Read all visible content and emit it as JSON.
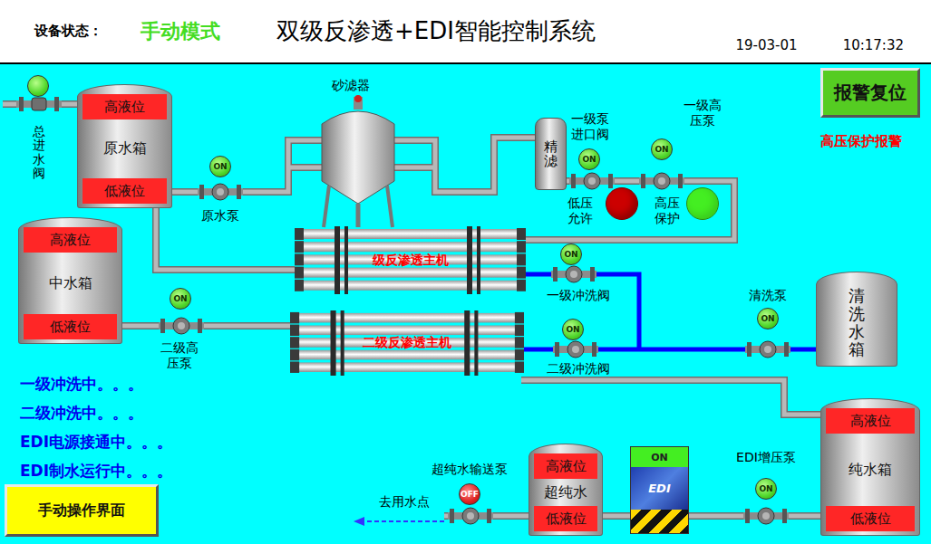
{
  "header": {
    "status_label": "设备状态：",
    "mode": "手动模式",
    "title": "双级反渗透+EDI智能控制系统",
    "date": "19-03-01",
    "time": "10:17:32"
  },
  "buttons": {
    "alarm_reset": "报警复位",
    "manual": "手动操作界面"
  },
  "alarm": "高压保护报警",
  "inlet_valve": {
    "label": "总进水阀",
    "on": true
  },
  "sand_filter": "砂滤器",
  "fine_filter": "精滤",
  "tanks": [
    {
      "kind": "levels",
      "name": "原水箱",
      "high": "高液位",
      "low": "低液位",
      "high_active": true,
      "low_active": true
    },
    {
      "kind": "levels",
      "name": "中水箱",
      "high": "高液位",
      "low": "低液位",
      "high_active": true,
      "low_active": true
    },
    {
      "kind": "levels",
      "name": "纯水箱",
      "high": "高液位",
      "low": "低液位",
      "high_active": true,
      "low_active": true
    },
    {
      "kind": "levels",
      "name": "超纯水",
      "high": "高液位",
      "low": "低液位",
      "high_active": true,
      "low_active": true
    },
    {
      "kind": "plain",
      "name": "清洗水箱"
    }
  ],
  "devices": [
    {
      "label": "原水泵",
      "indicator": "ON",
      "on": true
    },
    {
      "label": "一级泵进口阀",
      "indicator": "ON",
      "on": true
    },
    {
      "label": "一级高压泵",
      "indicator": "ON",
      "on": true
    },
    {
      "label": "一级冲洗阀",
      "indicator": "ON",
      "on": true
    },
    {
      "label": "二级冲洗阀",
      "indicator": "ON",
      "on": true
    },
    {
      "label": "清洗泵",
      "indicator": "ON",
      "on": true
    },
    {
      "label": "二级高压泵",
      "indicator": "ON",
      "on": true
    },
    {
      "label": "EDI增压泵",
      "indicator": "ON",
      "on": true
    },
    {
      "label": "超纯水输送泵",
      "indicator": "OFF",
      "on": false
    }
  ],
  "lamps": [
    {
      "label": "低压允许",
      "on": false,
      "color": "#cc0000"
    },
    {
      "label": "高压保护",
      "on": true,
      "color": "#44ee22"
    }
  ],
  "ro_units": [
    {
      "label": "级反渗透主机"
    },
    {
      "label": "二级反渗透主机"
    }
  ],
  "edi": {
    "state": "ON",
    "label": "EDI",
    "on": true
  },
  "outlet": "去用水点",
  "messages": [
    "一级冲洗中。。。",
    "二级冲洗中。。。",
    "EDI电源接通中。。。",
    "EDI制水运行中。。。"
  ]
}
